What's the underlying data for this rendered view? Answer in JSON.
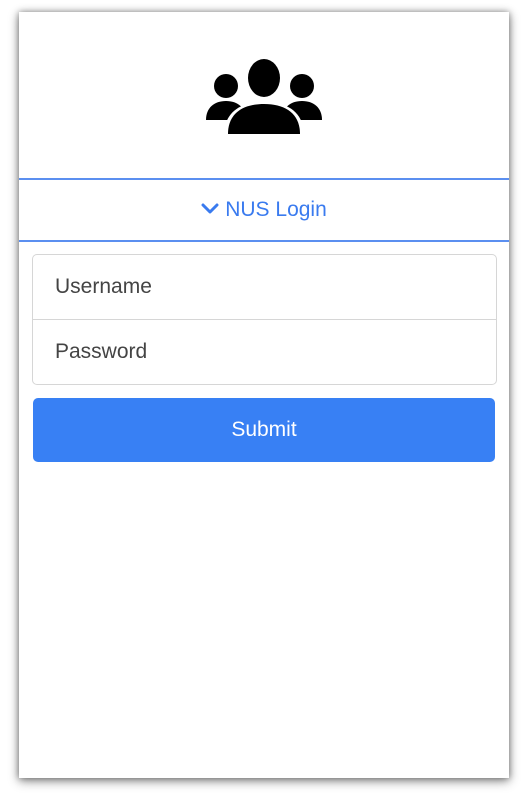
{
  "logo": {
    "icon": "users-group-icon"
  },
  "section": {
    "title": "NUS Login",
    "icon": "chevron-down-icon",
    "accent_color": "#3a7bef"
  },
  "form": {
    "username_placeholder": "Username",
    "password_placeholder": "Password",
    "submit_label": "Submit",
    "button_color": "#3880f4"
  }
}
